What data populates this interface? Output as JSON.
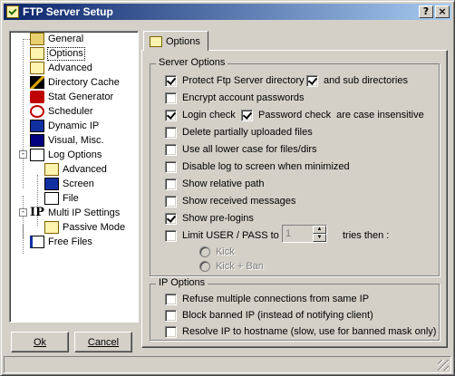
{
  "window": {
    "title": "FTP Server Setup"
  },
  "titlebar_buttons": {
    "help": "?",
    "close": "×"
  },
  "tree": {
    "items": [
      {
        "label": "General",
        "icon": "general-icon"
      },
      {
        "label": "Options",
        "icon": "options-icon",
        "selected": true
      },
      {
        "label": "Advanced",
        "icon": "advanced-icon"
      },
      {
        "label": "Directory Cache",
        "icon": "directory-cache-icon"
      },
      {
        "label": "Stat Generator",
        "icon": "stat-generator-icon"
      },
      {
        "label": "Scheduler",
        "icon": "scheduler-icon"
      },
      {
        "label": "Dynamic IP",
        "icon": "dynamic-ip-icon"
      },
      {
        "label": "Visual, Misc.",
        "icon": "visual-misc-icon"
      },
      {
        "label": "Log Options",
        "icon": "log-options-icon"
      },
      {
        "label": "Advanced",
        "icon": "log-advanced-icon"
      },
      {
        "label": "Screen",
        "icon": "log-screen-icon"
      },
      {
        "label": "File",
        "icon": "log-file-icon"
      },
      {
        "label": "Multi IP Settings",
        "icon": "multi-ip-icon"
      },
      {
        "label": "Passive Mode",
        "icon": "passive-mode-icon"
      },
      {
        "label": "Free Files",
        "icon": "free-files-icon"
      }
    ],
    "expanders": {
      "log": "-",
      "multi_ip": "-"
    }
  },
  "tab": {
    "label": "Options"
  },
  "server_options": {
    "title": "Server Options",
    "protect_dir": {
      "label": "Protect Ftp Server directory",
      "checked": true
    },
    "sub_dirs": {
      "label": "and sub directories",
      "checked": true
    },
    "encrypt": {
      "label": "Encrypt account passwords",
      "checked": false
    },
    "login_check": {
      "label": "Login check",
      "checked": true
    },
    "password_check": {
      "label": "Password check",
      "checked": true
    },
    "case_insensitive": "are case insensitive",
    "delete_partial": {
      "label": "Delete partially uploaded files",
      "checked": false
    },
    "lower_case": {
      "label": "Use all lower case for files/dirs",
      "checked": false
    },
    "disable_log": {
      "label": "Disable log to screen when minimized",
      "checked": false
    },
    "relative_path": {
      "label": "Show relative path",
      "checked": false
    },
    "received_msgs": {
      "label": "Show received messages",
      "checked": false
    },
    "pre_logins": {
      "label": "Show pre-logins",
      "checked": true
    },
    "limit_user": {
      "label": "Limit USER / PASS to",
      "checked": false,
      "value": "1",
      "suffix": "tries then :"
    },
    "kick": "Kick",
    "kick_ban": "Kick + Ban"
  },
  "ip_options": {
    "title": "IP Options",
    "refuse_multiple": {
      "label": "Refuse multiple connections from same IP",
      "checked": false
    },
    "block_banned": {
      "label": "Block banned IP (instead of notifying client)",
      "checked": false
    },
    "resolve_ip": {
      "label": "Resolve IP to hostname (slow, use for banned mask only)",
      "checked": false
    }
  },
  "buttons": {
    "ok": "Ok",
    "cancel": "Cancel"
  }
}
